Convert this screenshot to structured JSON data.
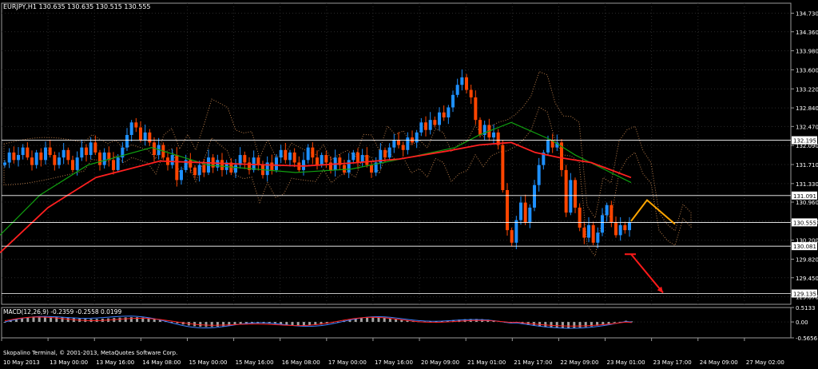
{
  "window": {
    "symbol_header": "EURJPY,H1  130.635 130.635 130.515 130.555",
    "macd_header": "MACD(12,26,9) -0.2359 -0.2558 0.0199",
    "copyright": "Skopalino Terminal, © 2001-2013, MetaQuotes Software Corp."
  },
  "colors": {
    "background": "#000000",
    "grid": "#2a2a2a",
    "bull_candle": "#1e90ff",
    "bear_candle": "#ff4500",
    "ma_fast": "#ff2020",
    "ma_slow": "#10a010",
    "cloud": "#f4a460",
    "projection": "#ffa500",
    "arrow": "#ff1a1a",
    "macd_hist": "#c0c0c0",
    "macd_signal": "#ff2020",
    "macd_main": "#4080ff",
    "hline": "#ffffff"
  },
  "price_axis": {
    "labels": [
      "134.730",
      "134.360",
      "133.980",
      "133.600",
      "133.220",
      "132.840",
      "132.470",
      "132.090",
      "131.710",
      "131.330",
      "130.960",
      "130.580",
      "130.200",
      "129.820",
      "129.450",
      "129.070"
    ],
    "highlighted": [
      "132.195",
      "131.091",
      "130.555",
      "130.081",
      "129.135"
    ]
  },
  "macd_axis": {
    "labels": [
      "0.5133",
      "0.00",
      "-0.5656"
    ]
  },
  "time_axis": {
    "labels": [
      "10 May 2013",
      "13 May 00:00",
      "13 May 16:00",
      "14 May 08:00",
      "15 May 00:00",
      "15 May 16:00",
      "16 May 08:00",
      "17 May 00:00",
      "17 May 16:00",
      "20 May 09:00",
      "21 May 01:00",
      "21 May 17:00",
      "22 May 09:00",
      "23 May 01:00",
      "23 May 17:00",
      "24 May 09:00",
      "27 May 02:00"
    ]
  },
  "chart_data": {
    "type": "candlestick",
    "title": "EURJPY,H1",
    "ylim": [
      128.92,
      134.93
    ],
    "hlines": [
      132.195,
      131.091,
      130.555,
      130.081,
      129.135
    ],
    "closes": [
      131.75,
      131.95,
      131.8,
      131.9,
      132.05,
      131.85,
      131.7,
      131.95,
      131.8,
      132.05,
      131.9,
      131.7,
      131.85,
      132.0,
      131.8,
      131.6,
      131.85,
      132.05,
      131.9,
      132.15,
      131.95,
      131.7,
      131.95,
      131.8,
      131.6,
      131.85,
      132.05,
      132.3,
      132.55,
      132.45,
      132.2,
      132.35,
      132.15,
      131.9,
      132.1,
      131.85,
      131.7,
      131.9,
      131.4,
      131.6,
      131.8,
      131.65,
      131.5,
      131.7,
      131.55,
      131.85,
      131.65,
      131.8,
      131.6,
      131.75,
      131.55,
      131.7,
      131.9,
      131.75,
      131.6,
      131.85,
      131.7,
      131.5,
      131.75,
      131.6,
      131.85,
      132.0,
      131.8,
      131.95,
      131.75,
      131.6,
      131.8,
      132.05,
      131.85,
      131.7,
      131.9,
      131.75,
      131.6,
      131.85,
      131.7,
      131.55,
      131.8,
      131.95,
      131.75,
      131.9,
      131.7,
      131.55,
      131.75,
      132.0,
      131.85,
      132.05,
      132.2,
      132.1,
      132.0,
      132.25,
      132.15,
      132.35,
      132.55,
      132.4,
      132.6,
      132.5,
      132.75,
      132.65,
      132.85,
      133.1,
      133.3,
      133.45,
      133.2,
      133.05,
      132.6,
      132.3,
      132.5,
      132.25,
      132.35,
      132.1,
      131.2,
      130.4,
      130.15,
      130.6,
      130.95,
      130.55,
      130.85,
      131.3,
      131.7,
      131.95,
      132.2,
      132.05,
      132.15,
      131.6,
      130.75,
      131.4,
      130.85,
      130.45,
      130.25,
      130.5,
      130.15,
      130.35,
      130.7,
      130.9,
      130.55,
      130.3,
      130.5,
      130.4,
      130.555
    ],
    "ma_fast": [
      [
        0,
        129.95
      ],
      [
        60,
        130.85
      ],
      [
        120,
        131.45
      ],
      [
        200,
        131.78
      ],
      [
        300,
        131.72
      ],
      [
        380,
        131.68
      ],
      [
        440,
        131.74
      ],
      [
        500,
        131.82
      ],
      [
        560,
        131.98
      ],
      [
        600,
        132.1
      ],
      [
        640,
        132.15
      ],
      [
        670,
        131.95
      ],
      [
        700,
        131.85
      ],
      [
        740,
        131.75
      ],
      [
        790,
        131.45
      ]
    ],
    "ma_slow": [
      [
        0,
        130.3
      ],
      [
        50,
        131.1
      ],
      [
        110,
        131.7
      ],
      [
        190,
        132.05
      ],
      [
        260,
        131.7
      ],
      [
        370,
        131.55
      ],
      [
        440,
        131.62
      ],
      [
        520,
        131.88
      ],
      [
        570,
        132.05
      ],
      [
        600,
        132.3
      ],
      [
        640,
        132.55
      ],
      [
        690,
        132.2
      ],
      [
        720,
        131.9
      ],
      [
        790,
        131.35
      ]
    ],
    "projection": [
      [
        790,
        130.58
      ],
      [
        810,
        131.0
      ],
      [
        845,
        130.52
      ]
    ],
    "arrow": {
      "from": [
        790,
        129.92
      ],
      "to": [
        830,
        129.15
      ]
    }
  }
}
